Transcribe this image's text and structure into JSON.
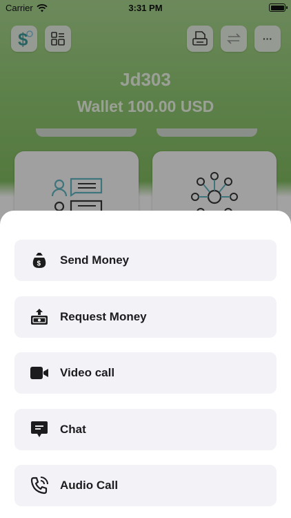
{
  "status_bar": {
    "carrier": "Carrier",
    "time": "3:31 PM"
  },
  "header": {
    "username": "Jd303",
    "wallet": "Wallet  100.00 USD"
  },
  "top_buttons": [
    {
      "icon": "dollar-icon"
    },
    {
      "icon": "grid-icon"
    },
    {
      "icon": "printer-icon"
    },
    {
      "icon": "transfer-icon"
    },
    {
      "icon": "more-icon",
      "label": "···"
    }
  ],
  "sheet": {
    "actions": [
      {
        "label": "Send Money",
        "icon": "money-bag-icon"
      },
      {
        "label": "Request Money",
        "icon": "request-money-icon"
      },
      {
        "label": "Video call",
        "icon": "video-camera-icon"
      },
      {
        "label": "Chat",
        "icon": "chat-bubble-icon"
      },
      {
        "label": "Audio Call",
        "icon": "phone-icon"
      }
    ]
  },
  "colors": {
    "accent_teal": "#5aa7b0",
    "text_dark": "#1c1c1e",
    "row_bg": "#f2f2f7"
  }
}
